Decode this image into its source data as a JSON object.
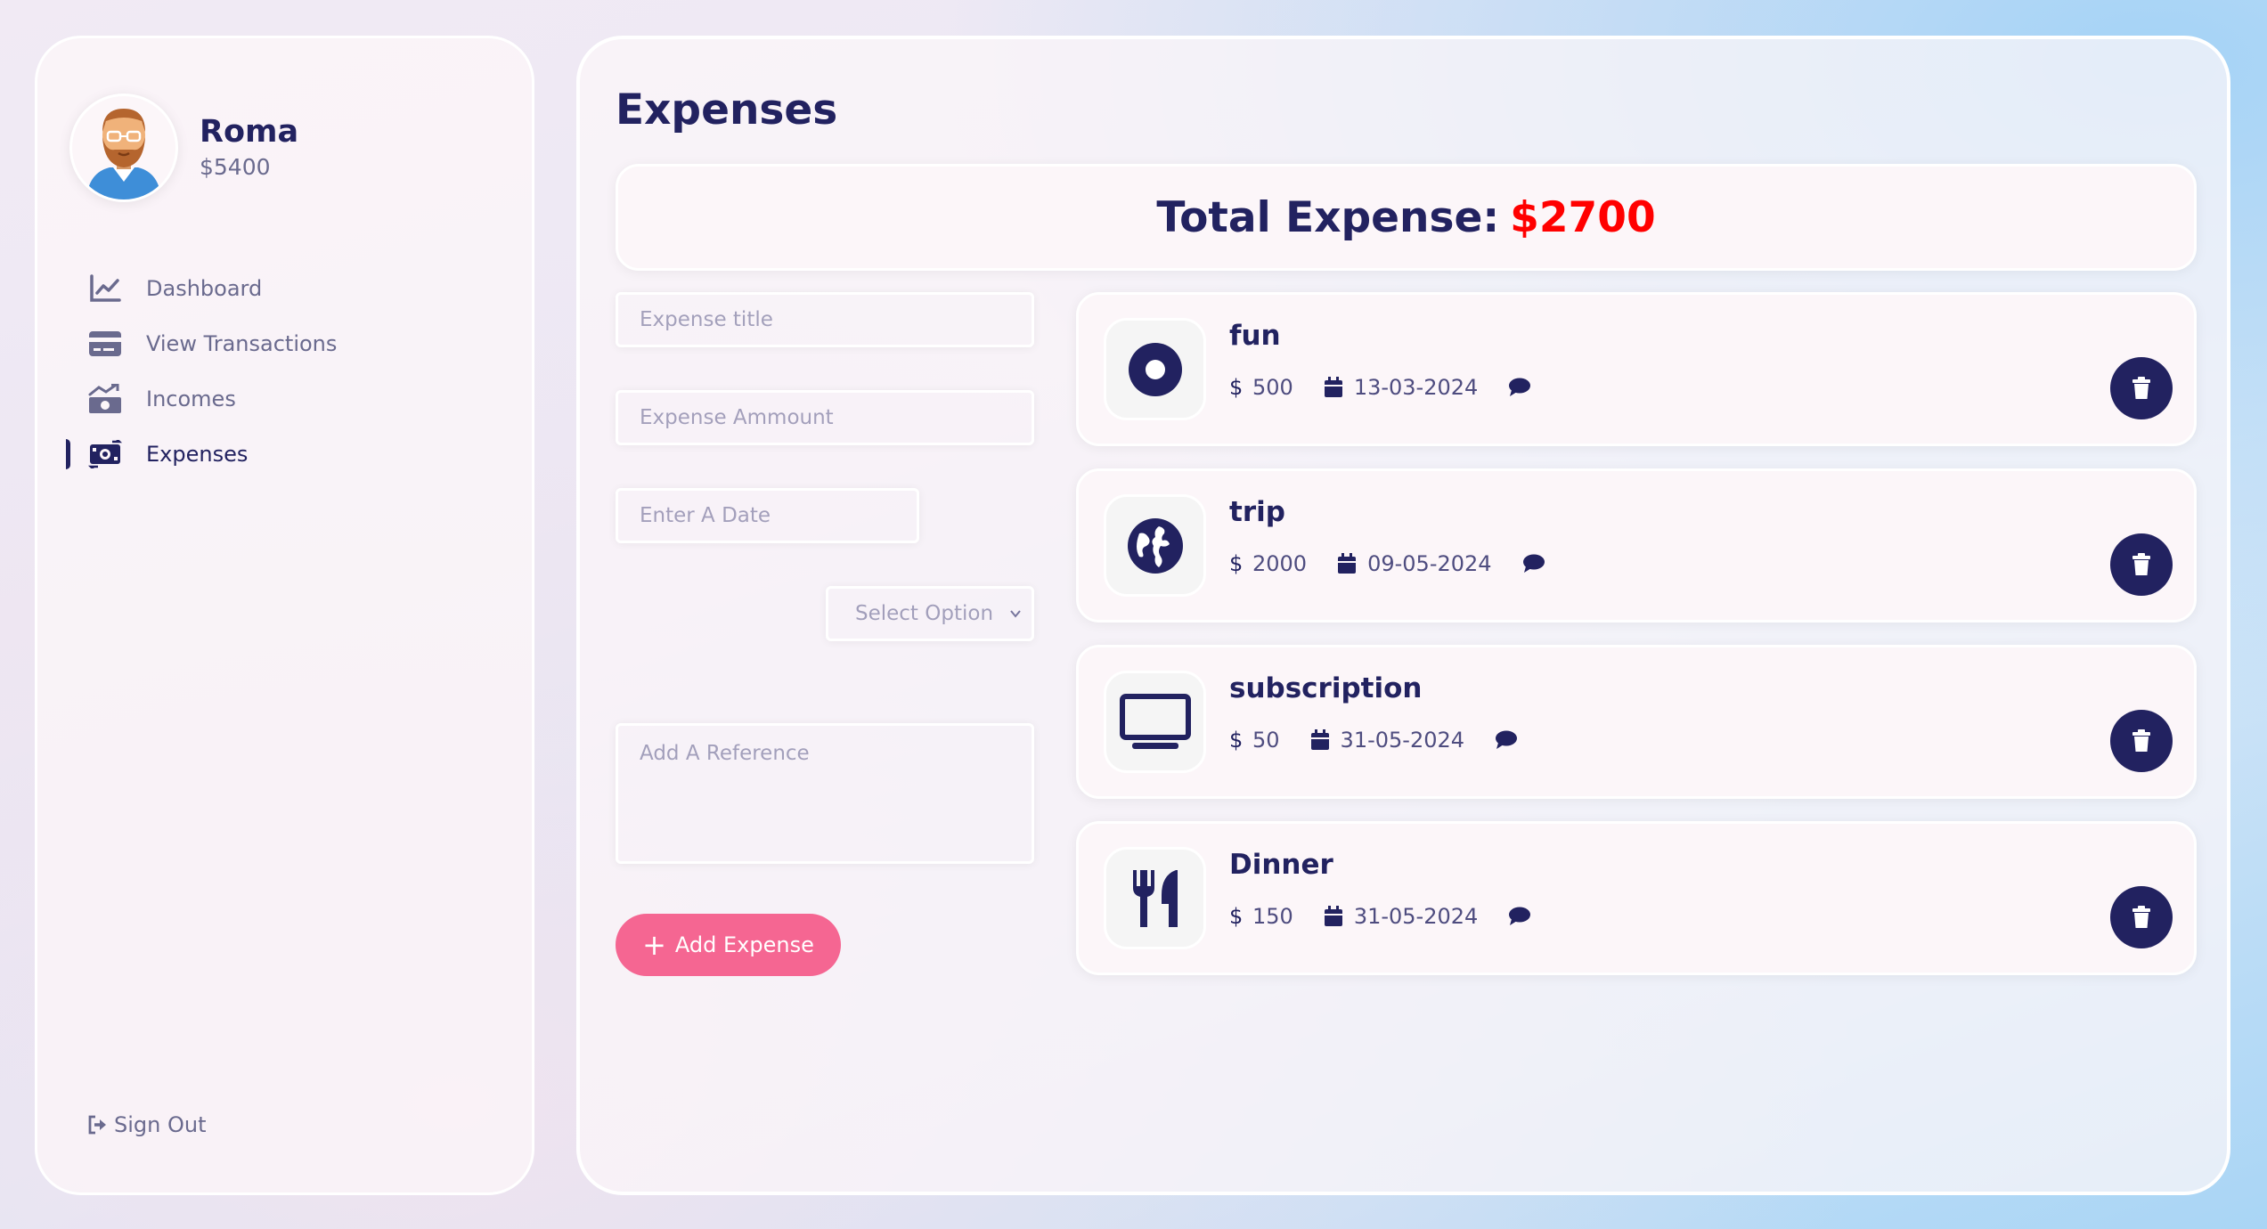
{
  "user": {
    "name": "Roma",
    "balance": "$5400"
  },
  "nav": {
    "items": [
      {
        "label": "Dashboard",
        "icon": "chart-line-icon"
      },
      {
        "label": "View Transactions",
        "icon": "credit-card-icon"
      },
      {
        "label": "Incomes",
        "icon": "money-bill-trend-up-icon"
      },
      {
        "label": "Expenses",
        "icon": "money-bill-transfer-icon",
        "active": true
      }
    ],
    "signout_label": "Sign Out"
  },
  "page": {
    "title": "Expenses"
  },
  "total": {
    "label": "Total Expense:",
    "amount": "$2700",
    "amount_color": "#ff0000"
  },
  "form": {
    "title_placeholder": "Expense title",
    "amount_placeholder": "Expense Ammount",
    "date_placeholder": "Enter A Date",
    "select_value": "Select Option",
    "reference_placeholder": "Add A Reference",
    "submit_label": "Add Expense"
  },
  "expenses": [
    {
      "title": "fun",
      "amount": "500",
      "date": "13-03-2024",
      "icon": "circle-dot-icon"
    },
    {
      "title": "trip",
      "amount": "2000",
      "date": "09-05-2024",
      "icon": "globe-icon"
    },
    {
      "title": "subscription",
      "amount": "50",
      "date": "31-05-2024",
      "icon": "tv-icon"
    },
    {
      "title": "Dinner",
      "amount": "150",
      "date": "31-05-2024",
      "icon": "utensils-icon"
    }
  ],
  "colors": {
    "primary": "#222260",
    "accent": "#f56692",
    "danger": "#ff0000"
  }
}
